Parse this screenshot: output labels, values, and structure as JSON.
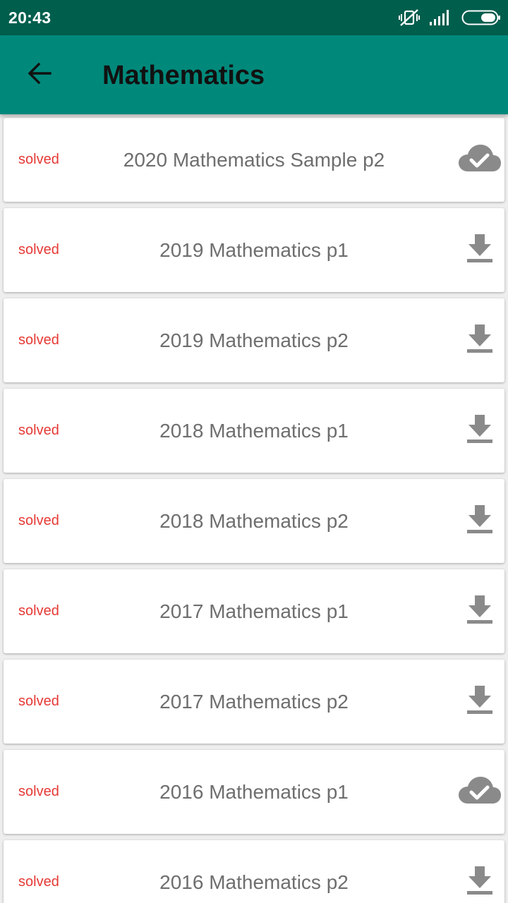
{
  "status_bar": {
    "time": "20:43",
    "icons": [
      "vibrate-off-icon",
      "signal-icon",
      "battery-icon"
    ]
  },
  "app_bar": {
    "back_icon": "arrow-left-icon",
    "title": "Mathematics",
    "color": "#00897b"
  },
  "colors": {
    "status_bar": "#005e4d",
    "solved_label": "#e53935",
    "title_text": "#6e6e6e",
    "icon": "#8a8a8a"
  },
  "papers": [
    {
      "status": "solved",
      "title": "2020 Mathematics Sample p2",
      "icon": "cloud-done-icon"
    },
    {
      "status": "solved",
      "title": "2019 Mathematics p1",
      "icon": "download-icon"
    },
    {
      "status": "solved",
      "title": "2019 Mathematics p2",
      "icon": "download-icon"
    },
    {
      "status": "solved",
      "title": "2018 Mathematics p1",
      "icon": "download-icon"
    },
    {
      "status": "solved",
      "title": "2018 Mathematics p2",
      "icon": "download-icon"
    },
    {
      "status": "solved",
      "title": "2017 Mathematics p1",
      "icon": "download-icon"
    },
    {
      "status": "solved",
      "title": "2017 Mathematics p2",
      "icon": "download-icon"
    },
    {
      "status": "solved",
      "title": "2016 Mathematics p1",
      "icon": "cloud-done-icon"
    },
    {
      "status": "solved",
      "title": "2016 Mathematics p2",
      "icon": "download-icon"
    }
  ]
}
